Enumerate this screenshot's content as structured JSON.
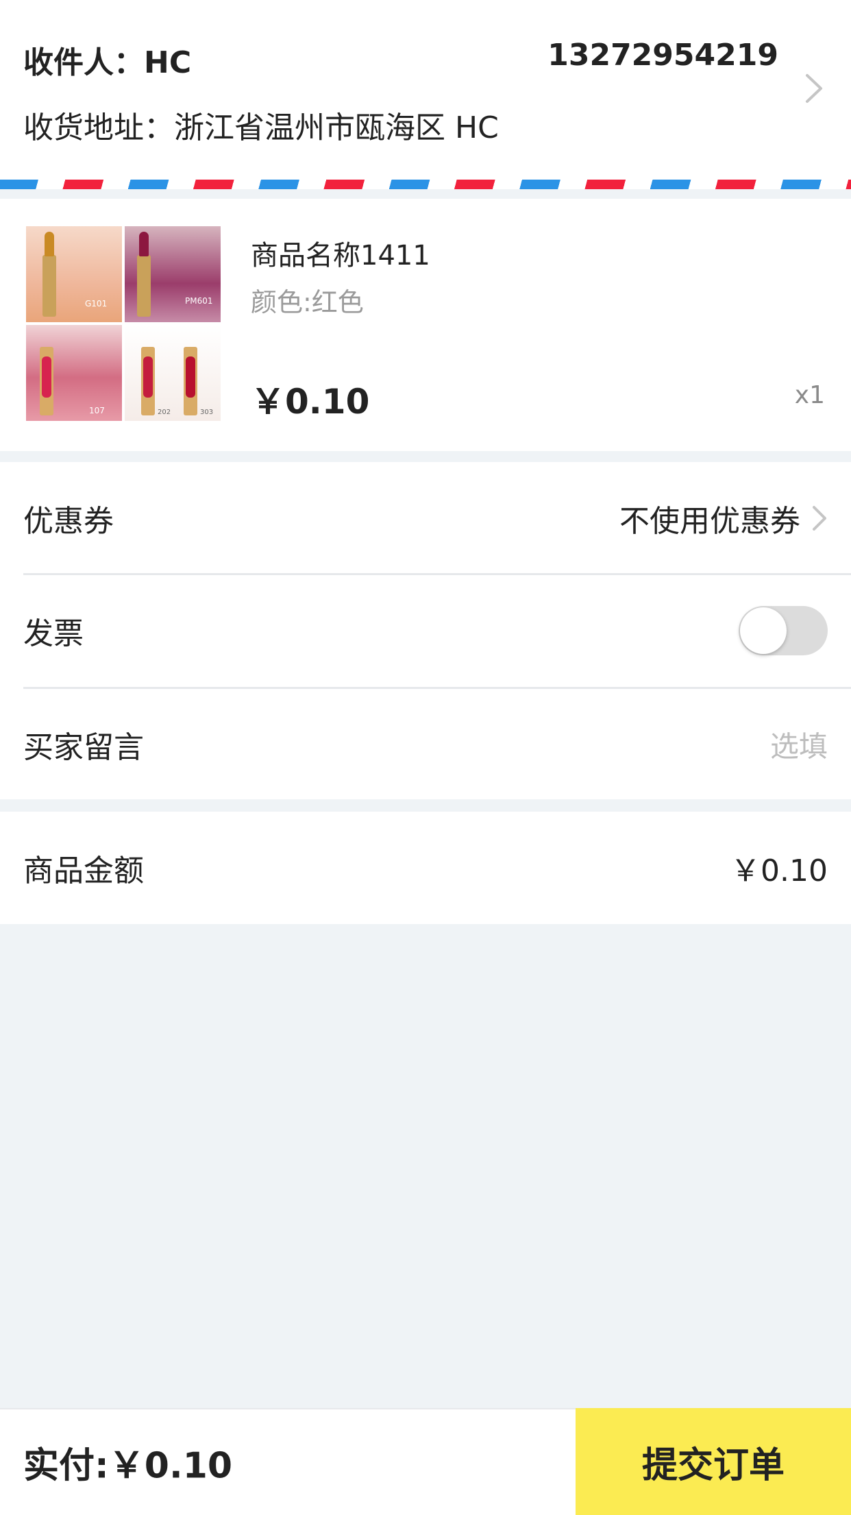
{
  "address": {
    "recipient_label": "收件人：",
    "recipient_name": "HC",
    "phone": "13272954219",
    "address_label": "收货地址：",
    "address_value": "浙江省温州市瓯海区 HC"
  },
  "product": {
    "name": "商品名称1411",
    "spec": "颜色:红色",
    "price": "￥0.10",
    "quantity": "x1",
    "image_labels": [
      "G101",
      "PM601",
      "107",
      "202",
      "303"
    ]
  },
  "options": {
    "coupon_label": "优惠券",
    "coupon_value": "不使用优惠券",
    "invoice_label": "发票",
    "invoice_enabled": false,
    "message_label": "买家留言",
    "message_placeholder": "选填"
  },
  "summary": {
    "amount_label": "商品金额",
    "amount_value": "￥0.10"
  },
  "footer": {
    "paid_label": "实付:",
    "paid_value": "￥0.10",
    "submit_label": "提交订单"
  },
  "colors": {
    "accent_yellow": "#fbeb52",
    "stripe_blue": "#2b93e6",
    "stripe_red": "#f2213c",
    "background": "#eff3f6"
  },
  "icons": {
    "address_chevron": "chevron-right-icon",
    "coupon_chevron": "chevron-right-icon"
  }
}
